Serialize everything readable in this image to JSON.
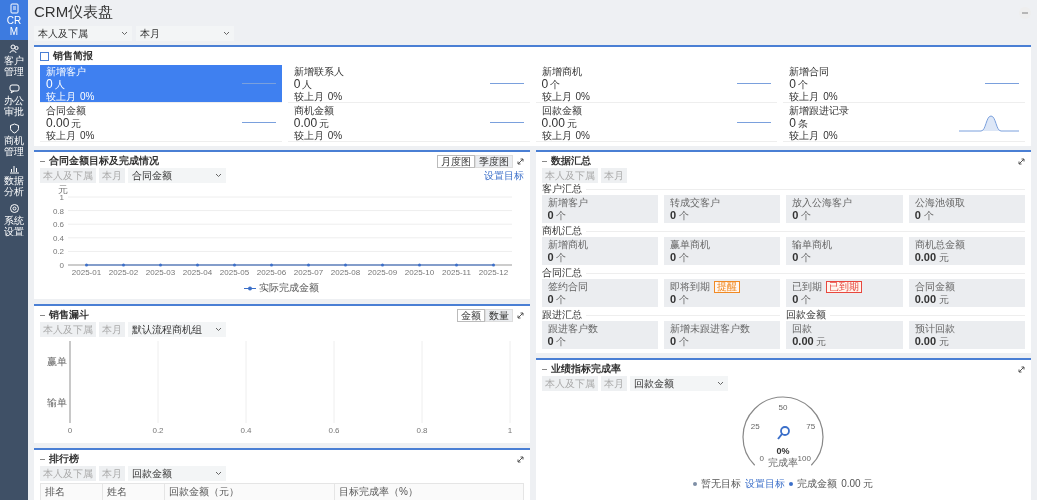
{
  "sidebar": {
    "items": [
      {
        "label": "CRM",
        "selected": true
      },
      {
        "label": "客户管理",
        "selected": false
      },
      {
        "label": "办公审批",
        "selected": false
      },
      {
        "label": "商机管理",
        "selected": false
      },
      {
        "label": "数据分析",
        "selected": false
      },
      {
        "label": "系统设置",
        "selected": false
      }
    ]
  },
  "header": {
    "title": "CRM仪表盘",
    "filters": [
      "本人及下属",
      "本月"
    ]
  },
  "sales_brief": {
    "title": "销售简报",
    "cards": [
      {
        "label": "新增客户",
        "value": "0",
        "unit": "人",
        "compare": "较上月",
        "change": "0%",
        "selected": true,
        "kind": "flat"
      },
      {
        "label": "新增联系人",
        "value": "0",
        "unit": "人",
        "compare": "较上月",
        "change": "0%",
        "selected": false,
        "kind": "flat"
      },
      {
        "label": "新增商机",
        "value": "0",
        "unit": "个",
        "compare": "较上月",
        "change": "0%",
        "selected": false,
        "kind": "flat"
      },
      {
        "label": "新增合同",
        "value": "0",
        "unit": "个",
        "compare": "较上月",
        "change": "0%",
        "selected": false,
        "kind": "flat"
      },
      {
        "label": "合同金额",
        "value": "0.00",
        "unit": "元",
        "compare": "较上月",
        "change": "0%",
        "selected": false,
        "kind": "flat"
      },
      {
        "label": "商机金额",
        "value": "0.00",
        "unit": "元",
        "compare": "较上月",
        "change": "0%",
        "selected": false,
        "kind": "flat"
      },
      {
        "label": "回款金额",
        "value": "0.00",
        "unit": "元",
        "compare": "较上月",
        "change": "0%",
        "selected": false,
        "kind": "flat"
      },
      {
        "label": "新增跟进记录",
        "value": "0",
        "unit": "条",
        "compare": "较上月",
        "change": "0%",
        "selected": false,
        "kind": "peak"
      }
    ]
  },
  "contract_chart": {
    "title": "合同金额目标及完成情况",
    "toggles": [
      {
        "label": "月度图",
        "selected": true
      },
      {
        "label": "季度图",
        "selected": false
      }
    ],
    "chips": [
      "本人及下属",
      "本月"
    ],
    "select": "合同金额",
    "link": "设置目标",
    "chart_data": {
      "type": "line",
      "ylabel": "元",
      "categories": [
        "2025-01",
        "2025-02",
        "2025-03",
        "2025-04",
        "2025-05",
        "2025-06",
        "2025-07",
        "2025-08",
        "2025-09",
        "2025-10",
        "2025-11",
        "2025-12"
      ],
      "series": [
        {
          "name": "实际完成金额",
          "color": "#3b6fc9",
          "values": [
            0,
            0,
            0,
            0,
            0,
            0,
            0,
            0,
            0,
            0,
            0,
            0
          ]
        }
      ],
      "ylim": [
        0,
        1
      ],
      "yticks": [
        0,
        0.2,
        0.4,
        0.6,
        0.8,
        1
      ],
      "grid": true
    }
  },
  "funnel": {
    "title": "销售漏斗",
    "toggles": [
      {
        "label": "金额",
        "selected": true
      },
      {
        "label": "数量",
        "selected": false
      }
    ],
    "chips": [
      "本人及下属",
      "本月"
    ],
    "select": "默认流程商机组",
    "chart_data": {
      "type": "bar",
      "orientation": "horizontal",
      "categories": [
        "赢单",
        "输单"
      ],
      "values": [
        0,
        0
      ],
      "xlim": [
        0,
        1
      ],
      "xticks": [
        0,
        0.2,
        0.4,
        0.6,
        0.8,
        1
      ],
      "grid": true
    }
  },
  "ranking": {
    "title": "排行榜",
    "chips": [
      "本人及下属",
      "本月"
    ],
    "select": "回款金额",
    "columns": [
      "排名",
      "姓名",
      "回款金额（元）",
      "目标完成率（%）"
    ]
  },
  "summary": {
    "title": "数据汇总",
    "chips": [
      "本人及下属",
      "本月"
    ],
    "groups": [
      {
        "title": "客户汇总",
        "items": [
          {
            "label": "新增客户",
            "value": "0",
            "unit": "个"
          },
          {
            "label": "转成交客户",
            "value": "0",
            "unit": "个"
          },
          {
            "label": "放入公海客户",
            "value": "0",
            "unit": "个"
          },
          {
            "label": "公海池领取",
            "value": "0",
            "unit": "个"
          }
        ]
      },
      {
        "title": "商机汇总",
        "items": [
          {
            "label": "新增商机",
            "value": "0",
            "unit": "个"
          },
          {
            "label": "赢单商机",
            "value": "0",
            "unit": "个"
          },
          {
            "label": "输单商机",
            "value": "0",
            "unit": "个"
          },
          {
            "label": "商机总金额",
            "value": "0.00",
            "unit": "元"
          }
        ]
      },
      {
        "title": "合同汇总",
        "items": [
          {
            "label": "签约合同",
            "value": "0",
            "unit": "个"
          },
          {
            "label": "即将到期",
            "value": "0",
            "unit": "个",
            "badge": "提醒",
            "color": "#f08a24"
          },
          {
            "label": "已到期",
            "value": "0",
            "unit": "个",
            "badge": "已到期",
            "color": "#e8473e"
          },
          {
            "label": "合同金额",
            "value": "0.00",
            "unit": "元"
          }
        ]
      },
      {
        "title": "跟进汇总",
        "items": [
          {
            "label": "跟进客户数",
            "value": "0",
            "unit": "个"
          },
          {
            "label": "新增未跟进客户数",
            "value": "0",
            "unit": "个"
          }
        ]
      },
      {
        "title": "回款金额",
        "items": [
          {
            "label": "回款",
            "value": "0.00",
            "unit": "元"
          },
          {
            "label": "预计回款",
            "value": "0.00",
            "unit": "元"
          }
        ]
      }
    ]
  },
  "performance": {
    "title": "业绩指标完成率",
    "chips": [
      "本人及下属",
      "本月"
    ],
    "select": "回款金额",
    "gauge": {
      "ticks": [
        "0",
        "25",
        "50",
        "75",
        "100"
      ],
      "value": "0%",
      "caption": "完成率"
    },
    "legend": {
      "no_target": "暂无目标",
      "link": "设置目标",
      "completed_label": "完成金额",
      "completed_value": "0.00 元"
    }
  }
}
